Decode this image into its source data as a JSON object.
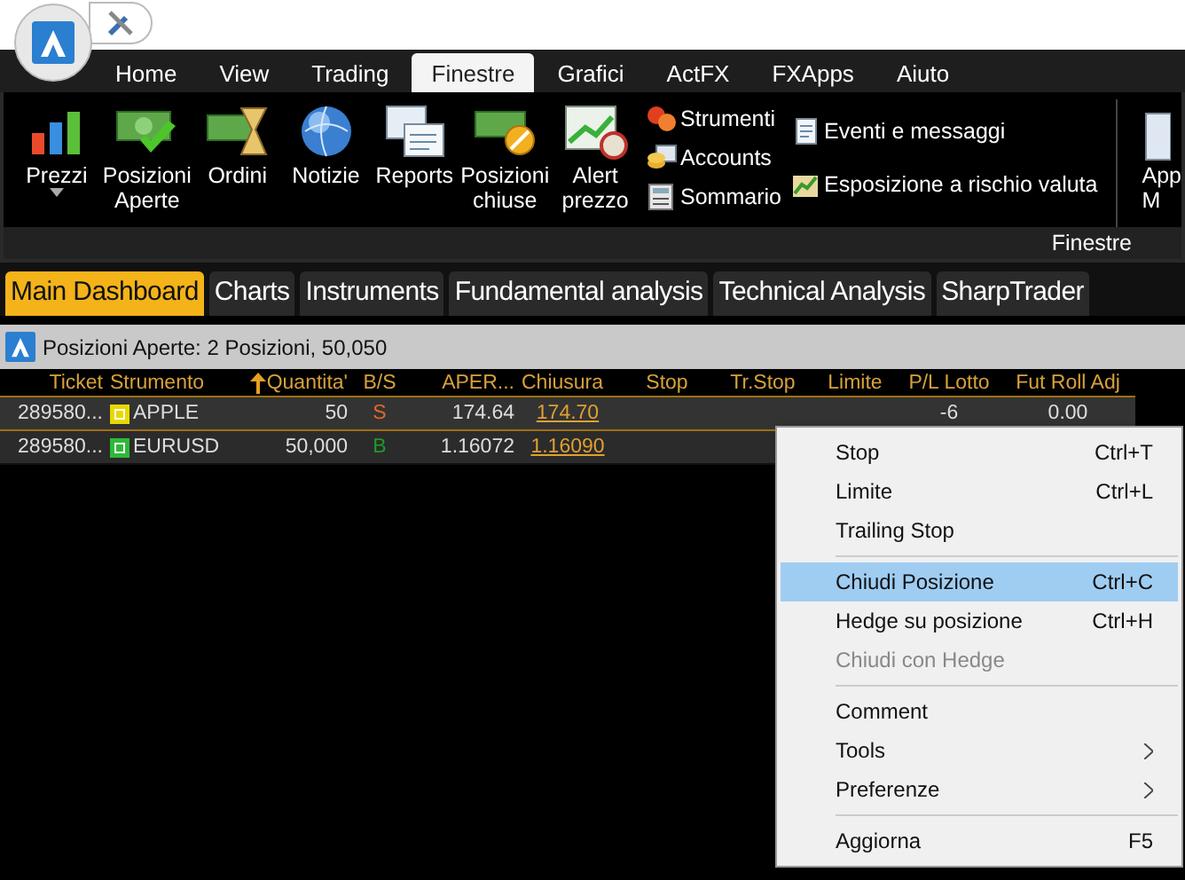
{
  "menu_tabs": [
    {
      "label": "Home",
      "selected": false
    },
    {
      "label": "View",
      "selected": false
    },
    {
      "label": "Trading",
      "selected": false
    },
    {
      "label": "Finestre",
      "selected": true
    },
    {
      "label": "Grafici",
      "selected": false
    },
    {
      "label": "ActFX",
      "selected": false
    },
    {
      "label": "FXApps",
      "selected": false
    },
    {
      "label": "Aiuto",
      "selected": false
    }
  ],
  "ribbon": {
    "large_buttons": [
      {
        "label": "Prezzi",
        "dropdown": true
      },
      {
        "label": "Posizioni\nAperte",
        "dropdown": false
      },
      {
        "label": "Ordini",
        "dropdown": false
      },
      {
        "label": "Notizie",
        "dropdown": false
      },
      {
        "label": "Reports",
        "dropdown": false
      },
      {
        "label": "Posizioni\nchiuse",
        "dropdown": false
      },
      {
        "label": "Alert\nprezzo",
        "dropdown": false
      }
    ],
    "small_buttons": [
      {
        "label": "Strumenti"
      },
      {
        "label": "Accounts"
      },
      {
        "label": "Sommario"
      }
    ],
    "wide_buttons": [
      {
        "label": "Eventi e messaggi"
      },
      {
        "label": "Esposizione a rischio valuta"
      }
    ],
    "cut_button": {
      "label": "App\nM"
    },
    "group_label": "Finestre"
  },
  "doc_tabs": [
    {
      "label": "Main Dashboard",
      "selected": true
    },
    {
      "label": "Charts",
      "selected": false
    },
    {
      "label": "Instruments",
      "selected": false
    },
    {
      "label": "Fundamental analysis",
      "selected": false
    },
    {
      "label": "Technical Analysis",
      "selected": false
    },
    {
      "label": "SharpTrader",
      "selected": false
    }
  ],
  "panel": {
    "title": "Posizioni Aperte: 2 Posizioni, 50,050",
    "columns": [
      {
        "label": "Ticket",
        "sorted": false
      },
      {
        "label": "Strumento",
        "sorted": false
      },
      {
        "label": "Quantita'",
        "sorted": true
      },
      {
        "label": "B/S",
        "sorted": false
      },
      {
        "label": "APER...",
        "sorted": false
      },
      {
        "label": "Chiusura",
        "sorted": false
      },
      {
        "label": "Stop",
        "sorted": false
      },
      {
        "label": "Tr.Stop",
        "sorted": false
      },
      {
        "label": "Limite",
        "sorted": false
      },
      {
        "label": "P/L Lotto",
        "sorted": false
      },
      {
        "label": "Fut Roll Adj",
        "sorted": false
      }
    ],
    "rows": [
      {
        "selected": true,
        "ticket": "289580...",
        "instrument": "APPLE",
        "color": "#e8d800",
        "quantity": "50",
        "side": {
          "text": "S",
          "color": "#e0662a"
        },
        "open": "174.64",
        "close": "174.70",
        "pl": "-6",
        "roll": "0.00"
      },
      {
        "selected": false,
        "ticket": "289580...",
        "instrument": "EURUSD",
        "color": "#2db83a",
        "quantity": "50,000",
        "side": {
          "text": "B",
          "color": "#1f9a2a"
        },
        "open": "1.16072",
        "close": "1.16090"
      }
    ]
  },
  "context_menu": {
    "items": [
      {
        "kind": "item",
        "label": "Stop",
        "shortcut": "Ctrl+T",
        "selected": false,
        "disabled": false,
        "submenu": false
      },
      {
        "kind": "item",
        "label": "Limite",
        "shortcut": "Ctrl+L",
        "selected": false,
        "disabled": false,
        "submenu": false
      },
      {
        "kind": "item",
        "label": "Trailing Stop",
        "selected": false,
        "disabled": false,
        "submenu": false
      },
      {
        "kind": "separator"
      },
      {
        "kind": "item",
        "label": "Chiudi Posizione",
        "shortcut": "Ctrl+C",
        "selected": true,
        "disabled": false,
        "submenu": false
      },
      {
        "kind": "item",
        "label": "Hedge su posizione",
        "shortcut": "Ctrl+H",
        "selected": false,
        "disabled": false,
        "submenu": false
      },
      {
        "kind": "item",
        "label": "Chiudi con Hedge",
        "selected": false,
        "disabled": true,
        "submenu": false
      },
      {
        "kind": "separator"
      },
      {
        "kind": "item",
        "label": "Comment",
        "selected": false,
        "disabled": false,
        "submenu": false
      },
      {
        "kind": "item",
        "label": "Tools",
        "selected": false,
        "disabled": false,
        "submenu": true
      },
      {
        "kind": "item",
        "label": "Preferenze",
        "selected": false,
        "disabled": false,
        "submenu": true
      },
      {
        "kind": "separator"
      },
      {
        "kind": "item",
        "label": "Aggiorna",
        "shortcut": "F5",
        "selected": false,
        "disabled": false,
        "submenu": false
      }
    ]
  }
}
